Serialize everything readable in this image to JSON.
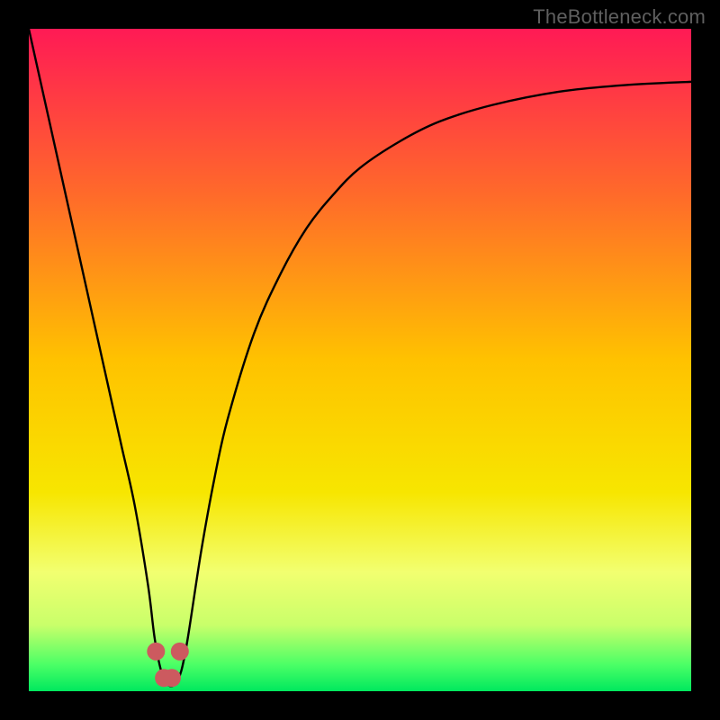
{
  "watermark": "TheBottleneck.com",
  "chart_data": {
    "type": "line",
    "title": "",
    "xlabel": "",
    "ylabel": "",
    "xlim": [
      0,
      100
    ],
    "ylim": [
      0,
      100
    ],
    "x": [
      0,
      2,
      4,
      6,
      8,
      10,
      12,
      14,
      16,
      18,
      19,
      20,
      21,
      22,
      23,
      24,
      26,
      28,
      30,
      34,
      38,
      42,
      46,
      50,
      56,
      62,
      70,
      80,
      90,
      100
    ],
    "values": [
      100,
      91,
      82,
      73,
      64,
      55,
      46,
      37,
      28,
      16,
      8,
      3,
      1,
      1,
      3,
      8,
      21,
      32,
      41,
      54,
      63,
      70,
      75,
      79,
      83,
      86,
      88.5,
      90.5,
      91.5,
      92
    ],
    "markers": {
      "x": [
        19.2,
        20.4,
        21.6,
        22.8
      ],
      "y": [
        6,
        2,
        2,
        6
      ],
      "size": 10,
      "color": "#cc5a5f"
    },
    "gradient_stops": [
      {
        "pos": 0.0,
        "color": "#ff1a55"
      },
      {
        "pos": 0.25,
        "color": "#ff6a2a"
      },
      {
        "pos": 0.5,
        "color": "#ffc200"
      },
      {
        "pos": 0.7,
        "color": "#f7e600"
      },
      {
        "pos": 0.82,
        "color": "#f2ff70"
      },
      {
        "pos": 0.9,
        "color": "#c9ff6a"
      },
      {
        "pos": 0.96,
        "color": "#4bff66"
      },
      {
        "pos": 1.0,
        "color": "#00e85e"
      }
    ],
    "curve_color": "#000000",
    "curve_width": 2.4
  }
}
